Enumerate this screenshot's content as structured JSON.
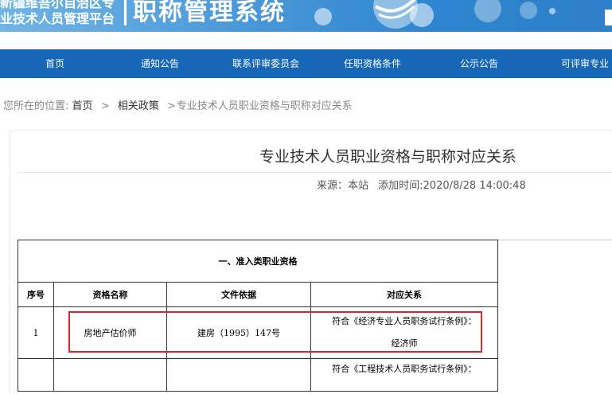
{
  "banner": {
    "org_line1": "新疆维吾尔自治区专",
    "org_line2": "业技术人员管理平台",
    "system_title": "职称管理系统"
  },
  "nav": {
    "items": [
      {
        "label": "首页"
      },
      {
        "label": "通知公告"
      },
      {
        "label": "联系评审委员会"
      },
      {
        "label": "任职资格条件"
      },
      {
        "label": "公示公告"
      },
      {
        "label": "可评审专业"
      }
    ]
  },
  "breadcrumb": {
    "prefix": "您所在的位置:",
    "home": "首页",
    "sep": ">",
    "section": "相关政策",
    "current": "专业技术人员职业资格与职称对应关系"
  },
  "article": {
    "title": "专业技术人员职业资格与职称对应关系",
    "source": "来源：本站",
    "time": "添加时间:2020/8/28 14:00:48"
  },
  "table": {
    "section_title": "一、准入类职业资格",
    "headers": [
      "序号",
      "资格名称",
      "文件依据",
      "对应关系"
    ],
    "rows": [
      {
        "no": "1",
        "name": "房地产估价师",
        "basis": "建房（1995）147号",
        "relation_line1": "符合《经济专业人员职务试行条例》：",
        "relation_line2": "经济师"
      },
      {
        "no": "",
        "name": "",
        "basis": "",
        "relation_line1": "符合《工程技术人员职务试行条例》：",
        "relation_line2": ""
      }
    ]
  },
  "colors": {
    "nav_bg": "#1667b7",
    "banner_bg": "#3f90d6",
    "highlight_border": "#e0202a"
  }
}
